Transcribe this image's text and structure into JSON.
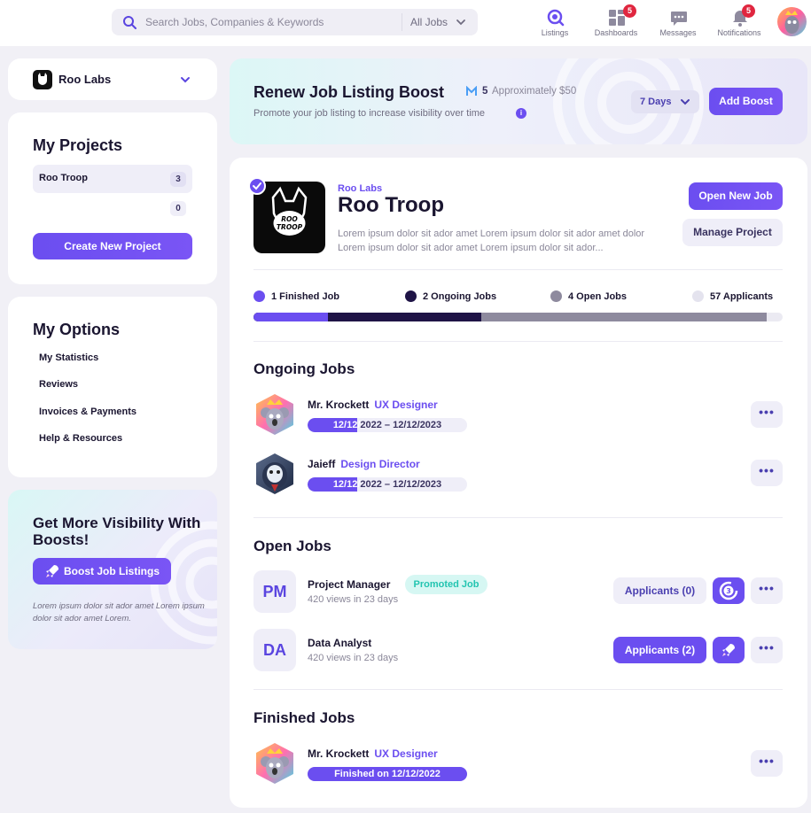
{
  "search": {
    "placeholder": "Search Jobs, Companies & Keywords",
    "filter": "All Jobs"
  },
  "nav": [
    {
      "label": "Listings",
      "badge": ""
    },
    {
      "label": "Dashboards",
      "badge": "5"
    },
    {
      "label": "Messages",
      "badge": ""
    },
    {
      "label": "Notifications",
      "badge": "5"
    }
  ],
  "org": {
    "name": "Roo Labs"
  },
  "projects": {
    "title": "My Projects",
    "items": [
      {
        "label": "Roo Troop",
        "count": "3"
      },
      {
        "label": "",
        "count": "0"
      }
    ],
    "create_label": "Create New Project"
  },
  "options": {
    "title": "My Options",
    "items": [
      "My Statistics",
      "Reviews",
      "Invoices & Payments",
      "Help & Resources"
    ]
  },
  "boost_card": {
    "title": "Get More Visibility With Boosts!",
    "button": "Boost Job Listings",
    "desc": "Lorem ipsum dolor sit ador amet Lorem ipsum dolor sit ador amet Lorem."
  },
  "renew": {
    "title": "Renew Job Listing Boost",
    "count": "5",
    "approx": "Approximately $50",
    "subtitle": "Promote your job listing to increase visibility over time",
    "duration": "7 Days",
    "add_label": "Add Boost"
  },
  "project": {
    "company": "Roo Labs",
    "title": "Roo Troop",
    "logo_text": "ROO TROOP",
    "desc": "Lorem ipsum dolor sit ador amet Lorem ipsum dolor sit ador amet dolor  Lorem ipsum dolor sit ador amet Lorem ipsum dolor sit ador...",
    "open_new": "Open New Job",
    "manage": "Manage Project"
  },
  "stats": {
    "finished": "1 Finished Job",
    "ongoing": "2 Ongoing Jobs",
    "open": "4 Open Jobs",
    "applicants": "57 Applicants",
    "progress": {
      "finished": 0.14,
      "ongoing": 0.43,
      "open": 0.97
    },
    "colors": {
      "finished": "#6b4ef0",
      "ongoing": "#1f1446",
      "open": "#8e8a9e",
      "applicants": "#e4e3ee"
    }
  },
  "ongoing": {
    "title": "Ongoing Jobs",
    "jobs": [
      {
        "name": "Mr. Krockett",
        "role": "UX Designer",
        "date_start": "12/12/",
        "date_rest": "2022  –  12/12/2023",
        "progress": 0.31
      },
      {
        "name": "Jaieff",
        "role": "Design Director",
        "date_start": "12/12/",
        "date_rest": "2022  –  12/12/2023",
        "progress": 0.31
      }
    ]
  },
  "open_jobs": {
    "title": "Open Jobs",
    "jobs": [
      {
        "initials": "PM",
        "title": "Project Manager",
        "views": "420 views in 23 days",
        "tag": "Promoted Job",
        "applicants": "Applicants (0)",
        "timer": "3"
      },
      {
        "initials": "DA",
        "title": "Data Analyst",
        "views": "420 views in 23 days",
        "tag": "",
        "applicants": "Applicants (2)"
      }
    ]
  },
  "finished": {
    "title": "Finished Jobs",
    "jobs": [
      {
        "name": "Mr. Krockett",
        "role": "UX Designer",
        "status": "Finished on 12/12/2022"
      }
    ]
  },
  "more_label": "•••",
  "colors": {
    "accent": "#6b4ef0",
    "teal": "#22c4b0",
    "badge": "#e0263f"
  }
}
